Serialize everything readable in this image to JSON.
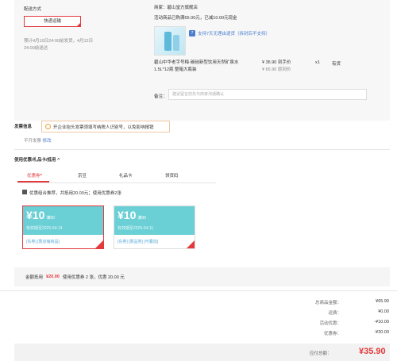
{
  "shipping": {
    "label": "配送方式",
    "method_button": "快递运输",
    "estimate_line1": "预计4月10日24:00前发货，4月12日",
    "estimate_line2": "24:00前送达"
  },
  "shop": {
    "seller_label": "商家：",
    "seller_name": "碧山堂方旗舰店",
    "promo": "活动商品已购满65.00元，已减10.00元现金",
    "return_tag": "支持7天无理由退货（拆封后不支持）",
    "product_name_line1": "碧山中华老字号梅·碳硅新型饮用天然矿泉水",
    "product_name_line2": "1.5L*12瓶 整箱大瓶装",
    "price": "¥ 35.90",
    "price_label": "到手价",
    "orig_price": "¥ 65.90",
    "orig_price_label": "原到价",
    "qty": "x1",
    "stock": "有货",
    "remark_label": "备注：",
    "remark_placeholder": "建议留言前先与商家沟通确认"
  },
  "invoice": {
    "label": "发票信息",
    "tip": "开企业抬头发票须填写纳税人识别号，以免影响报销",
    "status": "不开发票",
    "modify_link": "修改"
  },
  "coupons": {
    "section_title": "使用优惠/礼品卡/抵用",
    "chevron": "^",
    "tabs": [
      "优惠券",
      "京豆",
      "礼品卡",
      "领货码"
    ],
    "active_tab": "优惠券",
    "combo_text": "优惠组合推荐，共抵用20.00元；使用优惠券2张",
    "cards": [
      {
        "amount": "¥10",
        "condition": "满50",
        "date": "有效期至2025-04-14",
        "tags": "[东券] [限店铺商品]"
      },
      {
        "amount": "¥10",
        "condition": "满99",
        "date": "有效期至2025-04-11",
        "tags": "[东券] [限品类] [可叠加]"
      }
    ]
  },
  "discount_bar": {
    "label": "金额抵用",
    "amount": "¥20.00",
    "detail": "使用优惠券 2 张，优惠 20.00 元"
  },
  "summary": {
    "rows": [
      {
        "label": "总商品金额：",
        "value": "¥65.90"
      },
      {
        "label": "运费：",
        "value": "¥0.00"
      },
      {
        "label": "活动优惠：",
        "value": "-¥10.00"
      },
      {
        "label": "优惠券：",
        "value": "-¥20.00"
      }
    ],
    "payable_label": "应付总额：",
    "payable_value": "¥35.90"
  },
  "colors": {
    "accent": "#e4393c",
    "coupon_teal": "#6bd0d6",
    "link_blue": "#4a7fd0"
  }
}
